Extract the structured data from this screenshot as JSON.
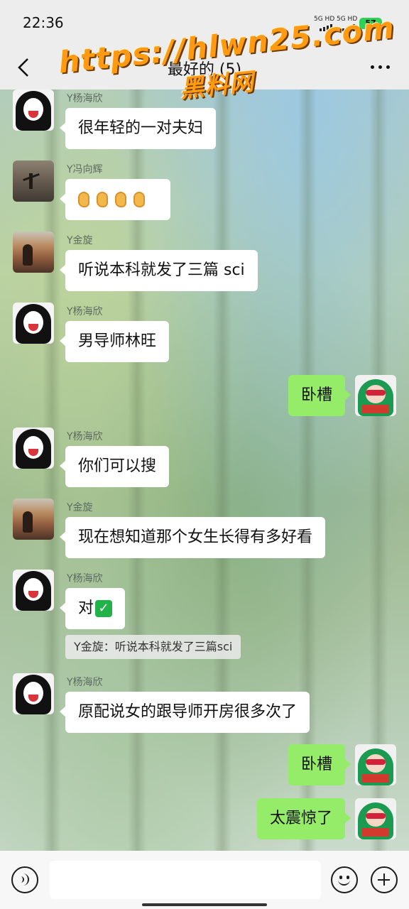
{
  "status_bar": {
    "time": "22:36",
    "network_1": "5G HD",
    "network_2": "5G HD",
    "battery": "57",
    "battery_color": "#2fd158"
  },
  "header": {
    "back_icon": "chevron-left-icon",
    "title": "最好的 (5)",
    "more_icon": "more-horizontal-icon"
  },
  "watermark": {
    "line1": "https://hlwn25.com",
    "line2": "黑料网"
  },
  "messages": [
    {
      "sender": "Y杨海欣",
      "text": "很年轻的一对夫妇",
      "direction": "in"
    },
    {
      "sender": "Y冯向辉",
      "text": "👂👂👂👂",
      "direction": "in"
    },
    {
      "sender": "Y金旋",
      "text": "听说本科就发了三篇 sci",
      "direction": "in"
    },
    {
      "sender": "Y杨海欣",
      "text": "男导师林旺",
      "direction": "in"
    },
    {
      "sender": "",
      "text": "卧槽",
      "direction": "out"
    },
    {
      "sender": "Y杨海欣",
      "text": "你们可以搜",
      "direction": "in"
    },
    {
      "sender": "Y金旋",
      "text": "现在想知道那个女生长得有多好看",
      "direction": "in"
    },
    {
      "sender": "Y杨海欣",
      "text": "对",
      "direction": "in",
      "emoji": "✅"
    },
    {
      "quote": "Y金旋：听说本科就发了三篇sci"
    },
    {
      "sender": "Y杨海欣",
      "text": "原配说女的跟导师开房很多次了",
      "direction": "in"
    },
    {
      "sender": "",
      "text": "卧槽",
      "direction": "out"
    },
    {
      "sender": "",
      "text": "太震惊了",
      "direction": "out"
    }
  ],
  "input_bar": {
    "voice_icon": "voice-icon",
    "input_value": "",
    "emoji_icon": "emoji-icon",
    "plus_icon": "plus-icon"
  },
  "colors": {
    "incoming_bubble": "#ffffff",
    "outgoing_bubble": "#95ec69",
    "bar_background": "#ededed"
  }
}
